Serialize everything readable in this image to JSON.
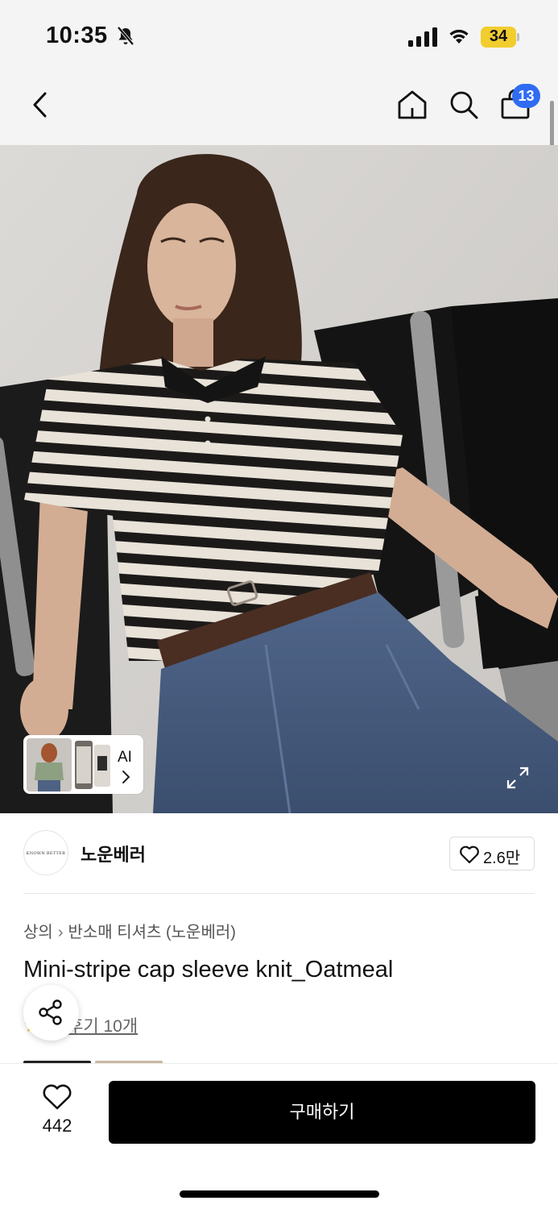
{
  "status_bar": {
    "time": "10:35",
    "battery": "34",
    "battery_color": "#f2cd2e"
  },
  "nav": {
    "back_icon": "chevron-left-icon",
    "home_icon": "home-icon",
    "search_icon": "search-icon",
    "bag_icon": "shopping-bag-icon",
    "bag_badge": "13",
    "badge_color": "#2f6cf2"
  },
  "hero": {
    "ai_label": "AI"
  },
  "brand": {
    "logo_text": "KNOWN BETTER",
    "name": "노운베러",
    "like_count": "2.6만"
  },
  "product": {
    "breadcrumb": [
      "상의",
      "반소매 티셔츠 (노운베러)"
    ],
    "title": "Mini-stripe cap sleeve knit_Oatmeal",
    "review_link": "후기 10개"
  },
  "bottom_bar": {
    "wish_count": "442",
    "buy_label": "구매하기"
  }
}
